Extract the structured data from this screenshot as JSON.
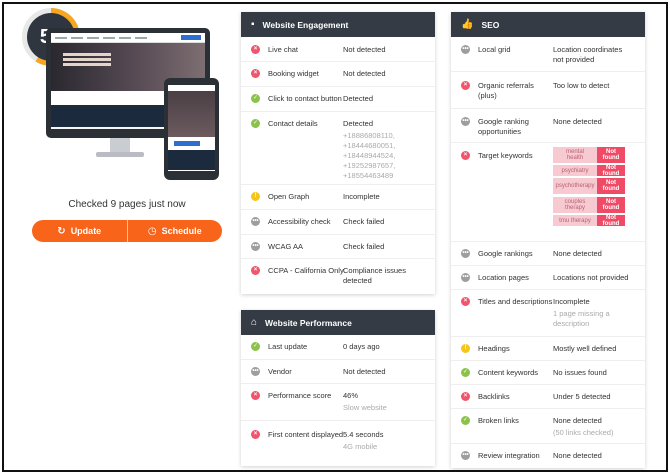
{
  "overview": {
    "score": "59",
    "checked_text": "Checked 9 pages just now",
    "update_label": "Update",
    "schedule_label": "Schedule",
    "colors": {
      "accent": "#f7641a",
      "score_ring": "#f5a623",
      "header": "#343b44"
    }
  },
  "engagement": {
    "title": "Website Engagement",
    "rows": [
      {
        "status": "red",
        "label": "Live chat",
        "value": "Not detected"
      },
      {
        "status": "red",
        "label": "Booking widget",
        "value": "Not detected"
      },
      {
        "status": "green",
        "label": "Click to contact button",
        "value": "Detected"
      },
      {
        "status": "green",
        "label": "Contact details",
        "value": "Detected",
        "subs": [
          "+18886808110,",
          "+18444680051,",
          "+18448944524,",
          "+19252987657,",
          "+18554463489"
        ]
      },
      {
        "status": "yellow",
        "label": "Open Graph",
        "value": "Incomplete"
      },
      {
        "status": "grey",
        "label": "Accessibility check",
        "value": "Check failed"
      },
      {
        "status": "grey",
        "label": "WCAG AA",
        "value": "Check failed"
      },
      {
        "status": "red",
        "label": "CCPA - California Only",
        "value": "Compliance issues",
        "value2": "detected"
      }
    ]
  },
  "performance": {
    "title": "Website Performance",
    "rows": [
      {
        "status": "green",
        "label": "Last update",
        "value": "0 days ago"
      },
      {
        "status": "grey",
        "label": "Vendor",
        "value": "Not detected"
      },
      {
        "status": "red",
        "label": "Performance score",
        "value": "46%",
        "sub": "Slow website"
      },
      {
        "status": "red",
        "label": "First content displayed",
        "value": "5.4 seconds",
        "sub": "4G mobile"
      }
    ]
  },
  "seo": {
    "title": "SEO",
    "rows": [
      {
        "status": "grey",
        "label": "Local grid",
        "value": "Location coordinates",
        "value2": "not provided"
      },
      {
        "status": "red",
        "label": "Organic referrals",
        "label2": "(plus)",
        "value": "Too low to detect"
      },
      {
        "status": "grey",
        "label": "Google ranking",
        "label2": "opportunities",
        "value": "None detected"
      },
      {
        "status": "red",
        "label": "Target keywords",
        "value": ""
      },
      {
        "status": "grey",
        "label": "Google rankings",
        "value": "None detected"
      },
      {
        "status": "grey",
        "label": "Location pages",
        "value": "Locations not provided"
      },
      {
        "status": "red",
        "label": "Titles and descriptions",
        "value": "Incomplete",
        "sub": "1 page missing a",
        "sub2": "description"
      },
      {
        "status": "yellow",
        "label": "Headings",
        "value": "Mostly well defined"
      },
      {
        "status": "green",
        "label": "Content keywords",
        "value": "No issues found"
      },
      {
        "status": "red",
        "label": "Backlinks",
        "value": "Under 5 detected"
      },
      {
        "status": "green",
        "label": "Broken links",
        "value": "None detected",
        "sub": "(50 links checked)"
      },
      {
        "status": "grey",
        "label": "Review integration",
        "value": "None detected"
      }
    ],
    "keywords": [
      {
        "k1": "mental",
        "k2": "health",
        "b1": "Not",
        "b2": "found"
      },
      {
        "k1": "psychiatry",
        "k2": "",
        "b1": "Not found",
        "b2": ""
      },
      {
        "k1": "psychotherapy",
        "k2": "",
        "b1": "Not",
        "b2": "found"
      },
      {
        "k1": "couples",
        "k2": "therapy",
        "b1": "Not",
        "b2": "found"
      },
      {
        "k1": "tmu therapy",
        "k2": "",
        "b1": "Not found",
        "b2": ""
      }
    ]
  }
}
